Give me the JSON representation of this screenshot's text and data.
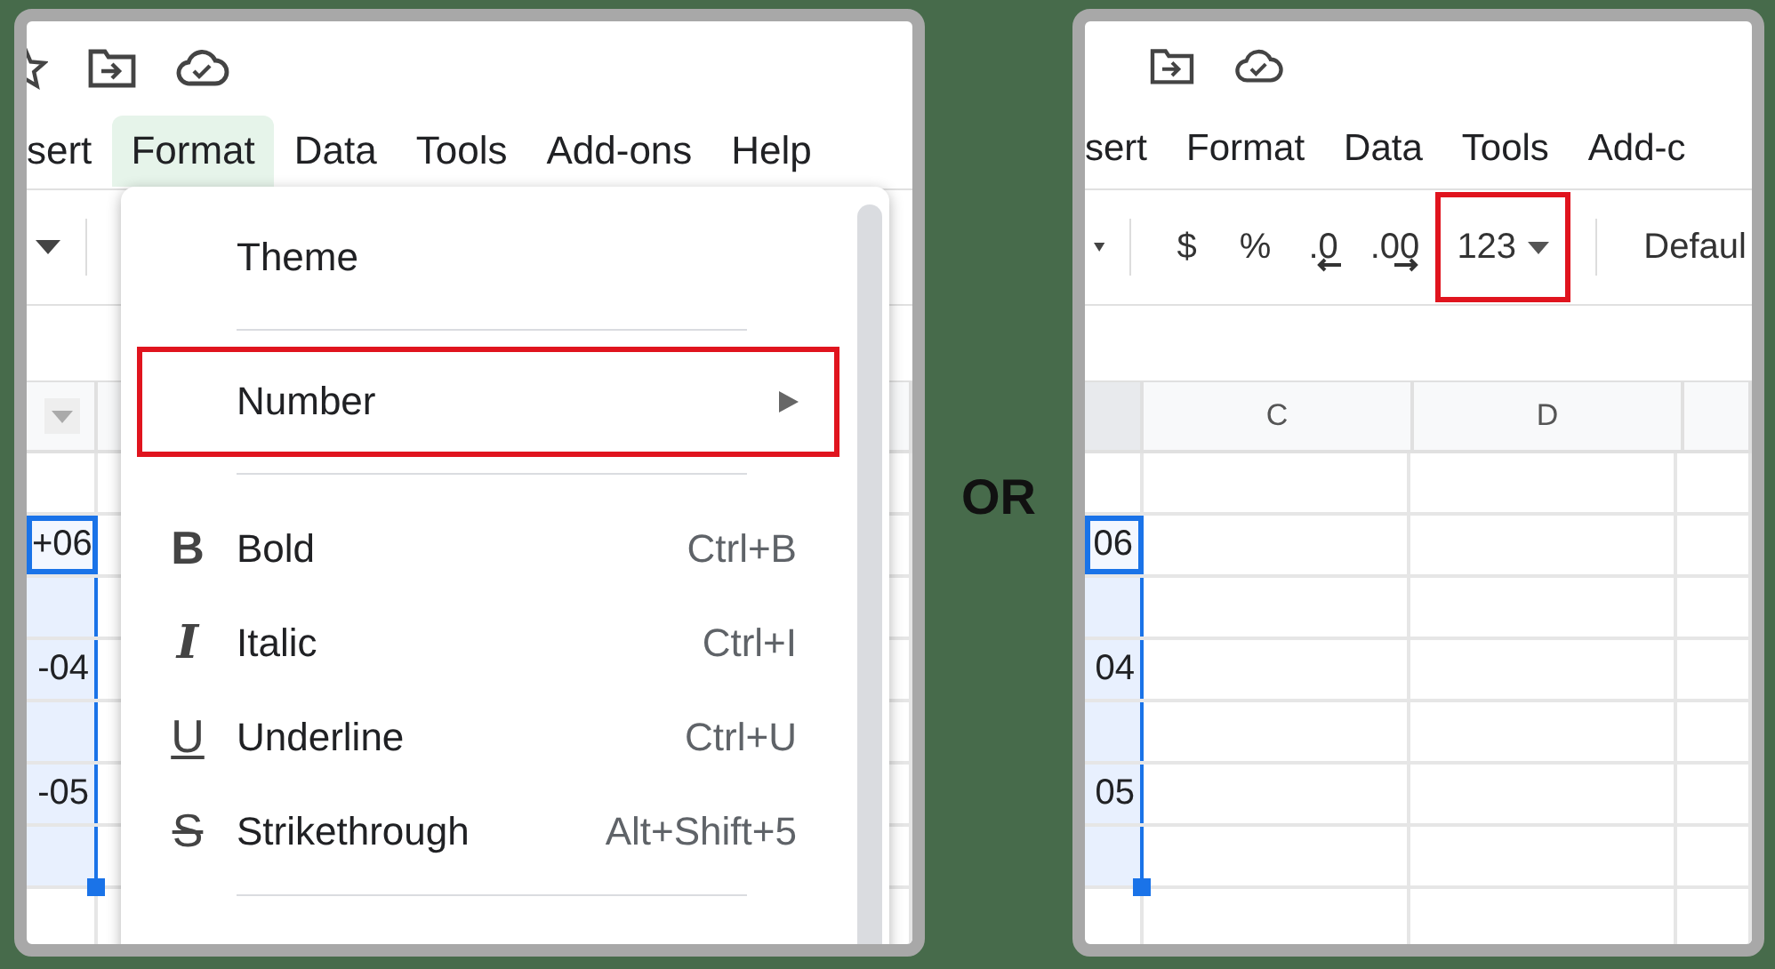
{
  "left_panel": {
    "menubar": [
      {
        "label": "sert",
        "selected": false
      },
      {
        "label": "Format",
        "selected": true
      },
      {
        "label": "Data",
        "selected": false
      },
      {
        "label": "Tools",
        "selected": false
      },
      {
        "label": "Add-ons",
        "selected": false
      },
      {
        "label": "Help",
        "selected": false
      }
    ],
    "format_menu": {
      "groups": [
        [
          {
            "kind": "plain",
            "label": "Theme",
            "highlighted": false
          }
        ],
        [
          {
            "kind": "submenu",
            "label": "Number",
            "highlighted": true
          }
        ],
        [
          {
            "kind": "bold",
            "glyph": "B",
            "label": "Bold",
            "shortcut": "Ctrl+B",
            "highlighted": false
          },
          {
            "kind": "italic",
            "glyph": "I",
            "label": "Italic",
            "shortcut": "Ctrl+I",
            "highlighted": false
          },
          {
            "kind": "underline",
            "glyph": "U",
            "label": "Underline",
            "shortcut": "Ctrl+U",
            "highlighted": false
          },
          {
            "kind": "strikethrough",
            "glyph": "S",
            "label": "Strikethrough",
            "shortcut": "Alt+Shift+5",
            "highlighted": false
          }
        ]
      ]
    },
    "rows": [
      {
        "selected": false,
        "active": false
      },
      {
        "selected": true,
        "active": true,
        "value": "+06"
      },
      {
        "selected": true,
        "active": false
      },
      {
        "selected": true,
        "active": false,
        "value": "-04"
      },
      {
        "selected": true,
        "active": false
      },
      {
        "selected": true,
        "active": false,
        "value": "-05"
      },
      {
        "selected": true,
        "active": false
      },
      {
        "selected": false,
        "active": false
      }
    ]
  },
  "separator_text": "OR",
  "right_panel": {
    "menubar": [
      {
        "label": "sert",
        "selected": false
      },
      {
        "label": "Format",
        "selected": false
      },
      {
        "label": "Data",
        "selected": false
      },
      {
        "label": "Tools",
        "selected": false
      },
      {
        "label": "Add-c",
        "selected": false
      }
    ],
    "toolbar": [
      {
        "kind": "symbol",
        "label": "$",
        "highlighted": false
      },
      {
        "kind": "symbol",
        "label": "%",
        "highlighted": false
      },
      {
        "kind": "decimal-decrease",
        "label": ".0",
        "highlighted": false
      },
      {
        "kind": "decimal-increase",
        "label": ".00",
        "highlighted": false
      },
      {
        "kind": "format-dropdown",
        "label": "123",
        "highlighted": true
      },
      {
        "kind": "font",
        "label": "Defaul",
        "highlighted": false
      }
    ],
    "columns": [
      "C",
      "D"
    ],
    "rows": [
      {
        "selected": false,
        "active": false
      },
      {
        "selected": true,
        "active": true,
        "value": "06"
      },
      {
        "selected": true,
        "active": false
      },
      {
        "selected": true,
        "active": false,
        "value": "04"
      },
      {
        "selected": true,
        "active": false
      },
      {
        "selected": true,
        "active": false,
        "value": "05"
      },
      {
        "selected": true,
        "active": false
      },
      {
        "selected": false,
        "active": false
      }
    ]
  }
}
